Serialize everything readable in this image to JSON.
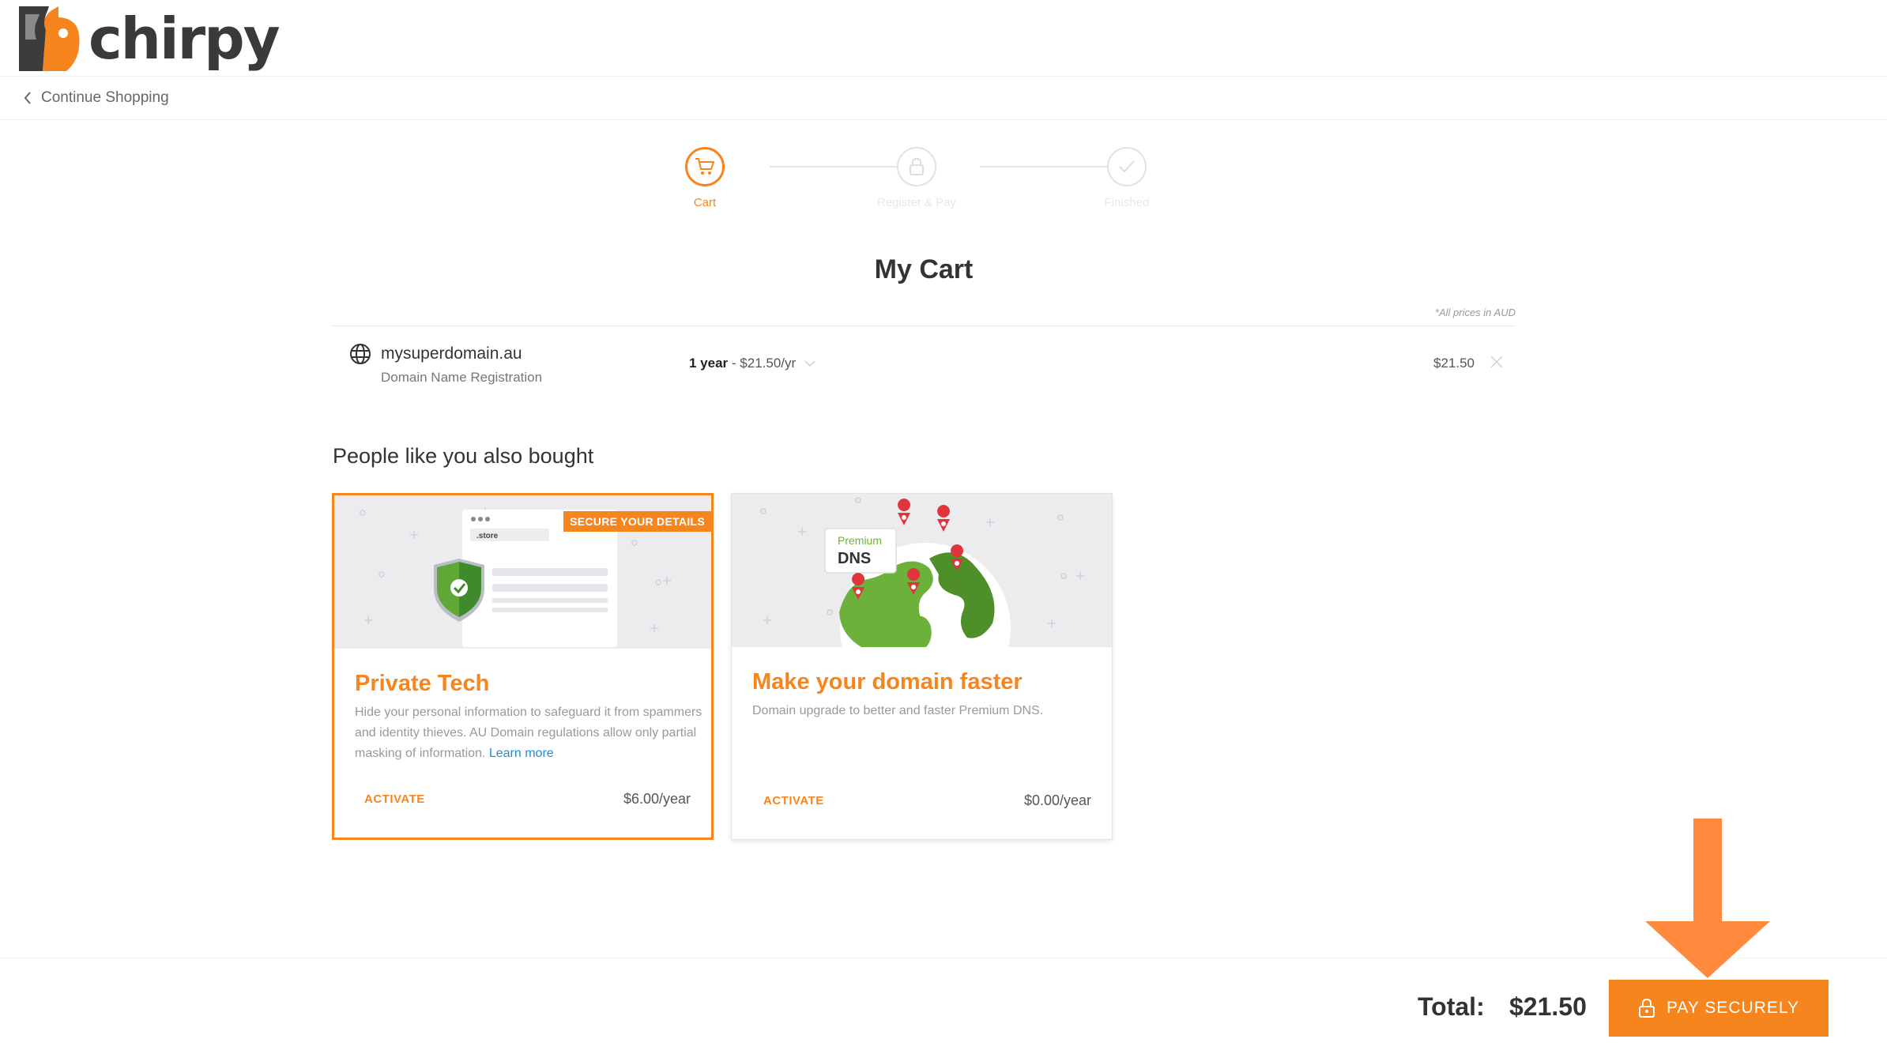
{
  "brand": {
    "name": "chirpy",
    "accent": "#f7851e"
  },
  "nav": {
    "continue_label": "Continue Shopping"
  },
  "steps": [
    {
      "label": "Cart",
      "icon": "cart-icon",
      "state": "active"
    },
    {
      "label": "Register & Pay",
      "icon": "lock-icon",
      "state": "pending"
    },
    {
      "label": "Finished",
      "icon": "check-icon",
      "state": "pending"
    }
  ],
  "cart": {
    "title": "My Cart",
    "prices_note": "*All prices in AUD",
    "item": {
      "icon": "globe-icon",
      "name": "mysuperdomain.au",
      "type": "Domain Name Registration",
      "period_bold": "1 year",
      "period_rest": " - $21.50/yr",
      "price": "$21.50"
    }
  },
  "upsell": {
    "heading": "People like you also bought",
    "cards": [
      {
        "badge": "SECURE YOUR DETAILS",
        "illustration_label": ".store",
        "title": "Private Tech",
        "description": "Hide your personal information to safeguard it from spammers and identity thieves. AU Domain regulations allow only partial masking of information.",
        "link": "Learn more",
        "action": "ACTIVATE",
        "price": "$6.00/year",
        "selected": true
      },
      {
        "illustration_label_small": "Premium",
        "illustration_label_big": "DNS",
        "title": "Make your domain faster",
        "description": "Domain upgrade to better and faster Premium DNS.",
        "action": "ACTIVATE",
        "price": "$0.00/year",
        "selected": false
      }
    ]
  },
  "footer": {
    "total_label": "Total:",
    "total_value": "$21.50",
    "pay_label": "PAY SECURELY"
  }
}
